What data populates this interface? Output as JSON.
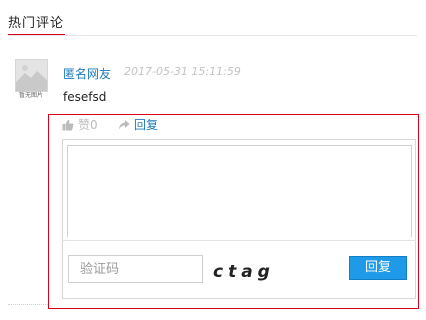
{
  "section": {
    "title": "热门评论"
  },
  "comment": {
    "avatar_caption": "暂无图片",
    "author": "匿名网友",
    "timestamp": "2017-05-31 15:11:59",
    "body": "fesefsd",
    "like_label": "赞0",
    "reply_label": "回复"
  },
  "reply_form": {
    "captcha_placeholder": "验证码",
    "captcha_code": "ctag",
    "submit_label": "回复"
  },
  "colors": {
    "accent_red": "#d9001b",
    "link_blue": "#1f7bbf",
    "button_blue": "#1e9ae8"
  },
  "icons": {
    "like": "thumbs-up-icon",
    "reply": "share-arrow-icon",
    "avatar": "image-placeholder-icon"
  }
}
